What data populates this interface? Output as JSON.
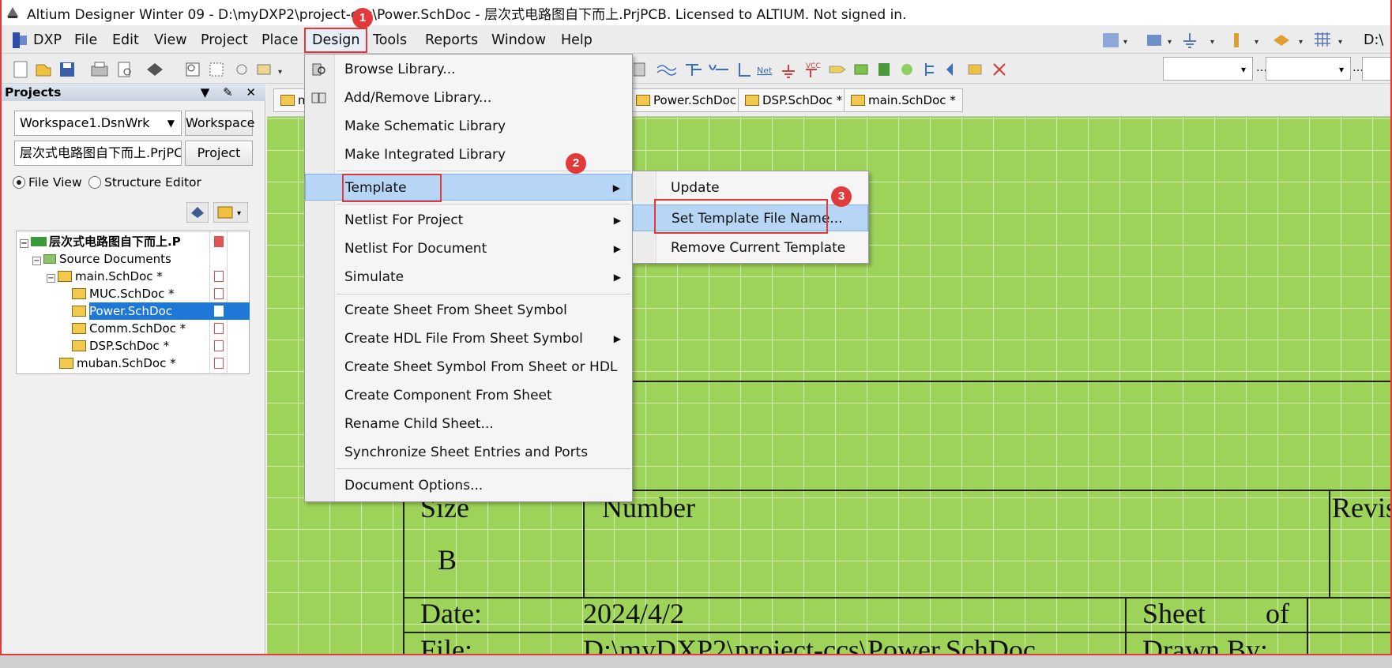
{
  "window": {
    "title": "Altium Designer Winter 09 - D:\\myDXP2\\project-ccs\\Power.SchDoc - 层次式电路图自下而上.PrjPCB. Licensed to ALTIUM. Not signed in."
  },
  "menubar": {
    "dxp": "DXP",
    "file": "File",
    "edit": "Edit",
    "view": "View",
    "project": "Project",
    "place": "Place",
    "design": "Design",
    "tools": "Tools",
    "reports": "Reports",
    "window": "Window",
    "help": "Help",
    "right_path": "D:\\"
  },
  "projects_panel": {
    "title": "Projects",
    "workspace_value": "Workspace1.DsnWrk",
    "workspace_button": "Workspace",
    "project_value": "层次式电路图自下而上.PrjPC",
    "project_button": "Project",
    "file_view": "File View",
    "structure_editor": "Structure Editor",
    "tree": {
      "project": "层次式电路图自下而上.P",
      "source_documents": "Source Documents",
      "items": [
        "main.SchDoc *",
        "MUC.SchDoc *",
        "Power.SchDoc",
        "Comm.SchDoc *",
        "DSP.SchDoc *",
        "muban.SchDoc *"
      ]
    }
  },
  "doc_tabs": {
    "tab0": "m",
    "tab1": "Power.SchDoc",
    "tab2": "DSP.SchDoc *",
    "tab3": "main.SchDoc *"
  },
  "design_menu": {
    "browse_library": "Browse Library...",
    "add_remove_library": "Add/Remove Library...",
    "make_schematic_library": "Make Schematic Library",
    "make_integrated_library": "Make Integrated Library",
    "template": "Template",
    "netlist_for_project": "Netlist For Project",
    "netlist_for_document": "Netlist For Document",
    "simulate": "Simulate",
    "create_sheet_from_symbol": "Create Sheet From Sheet Symbol",
    "create_hdl_file": "Create HDL File From Sheet Symbol",
    "create_sheet_symbol": "Create Sheet Symbol From Sheet or HDL",
    "create_component": "Create Component From Sheet",
    "rename_child_sheet": "Rename Child Sheet...",
    "synchronize": "Synchronize Sheet Entries and Ports",
    "document_options": "Document Options..."
  },
  "template_menu": {
    "update": "Update",
    "set_template_file_name": "Set Template File Name...",
    "remove_current_template": "Remove Current Template"
  },
  "title_block": {
    "size_label": "Size",
    "size_value": "B",
    "number_label": "Number",
    "revision_label": "Revis",
    "date_label": "Date:",
    "date_value": "2024/4/2",
    "sheet_label": "Sheet",
    "of_label": "of",
    "file_label": "File:",
    "file_value": "D:\\myDXP2\\project-ccs\\Power.SchDoc",
    "drawn_by_label": "Drawn By:"
  },
  "annotations": {
    "step1": "1",
    "step2": "2",
    "step3": "3",
    "color": "#e23a3a"
  },
  "colors": {
    "sheet_green": "#9ed35a",
    "menu_highlight": "#b7d6f5",
    "selected_tree": "#1e78d7"
  }
}
